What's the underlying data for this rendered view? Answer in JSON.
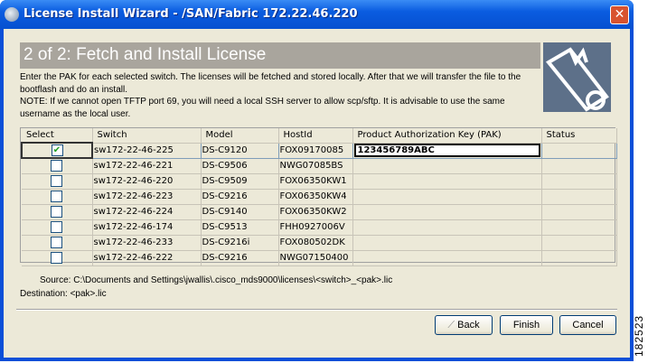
{
  "window": {
    "title": "License Install Wizard - /SAN/Fabric 172.22.46.220",
    "close": "✕"
  },
  "banner": {
    "title": "2 of 2: Fetch and Install License"
  },
  "description": {
    "line1": "Enter the PAK for each selected switch.  The licenses will be fetched and stored locally. After that we will transfer the file to the bootflash and do an install.",
    "line2": "NOTE: If we cannot open TFTP port 69, you will need a local SSH server to allow scp/sftp. It is advisable to use the same username as the local user."
  },
  "table": {
    "columns": [
      "Select",
      "Switch",
      "Model",
      "HostId",
      "Product Authorization Key (PAK)",
      "Status"
    ],
    "rows": [
      {
        "selected": true,
        "switch": "sw172-22-46-225",
        "model": "DS-C9120",
        "hostid": "FOX09170085",
        "pak": "123456789ABC",
        "status": ""
      },
      {
        "selected": false,
        "switch": "sw172-22-46-221",
        "model": "DS-C9506",
        "hostid": "NWG07085BS",
        "pak": "",
        "status": ""
      },
      {
        "selected": false,
        "switch": "sw172-22-46-220",
        "model": "DS-C9509",
        "hostid": "FOX06350KW1",
        "pak": "",
        "status": ""
      },
      {
        "selected": false,
        "switch": "sw172-22-46-223",
        "model": "DS-C9216",
        "hostid": "FOX06350KW4",
        "pak": "",
        "status": ""
      },
      {
        "selected": false,
        "switch": "sw172-22-46-224",
        "model": "DS-C9140",
        "hostid": "FOX06350KW2",
        "pak": "",
        "status": ""
      },
      {
        "selected": false,
        "switch": "sw172-22-46-174",
        "model": "DS-C9513",
        "hostid": "FHH0927006V",
        "pak": "",
        "status": ""
      },
      {
        "selected": false,
        "switch": "sw172-22-46-233",
        "model": "DS-C9216i",
        "hostid": "FOX080502DK",
        "pak": "",
        "status": ""
      },
      {
        "selected": false,
        "switch": "sw172-22-46-222",
        "model": "DS-C9216",
        "hostid": "NWG07150400",
        "pak": "",
        "status": ""
      }
    ]
  },
  "paths": {
    "source": "Source: C:\\Documents and Settings\\jwallis\\.cisco_mds9000\\licenses\\<switch>_<pak>.lic",
    "destination": "Destination: <pak>.lic"
  },
  "buttons": {
    "back": "Back",
    "finish": "Finish",
    "cancel": "Cancel"
  },
  "figure_number": "182523"
}
